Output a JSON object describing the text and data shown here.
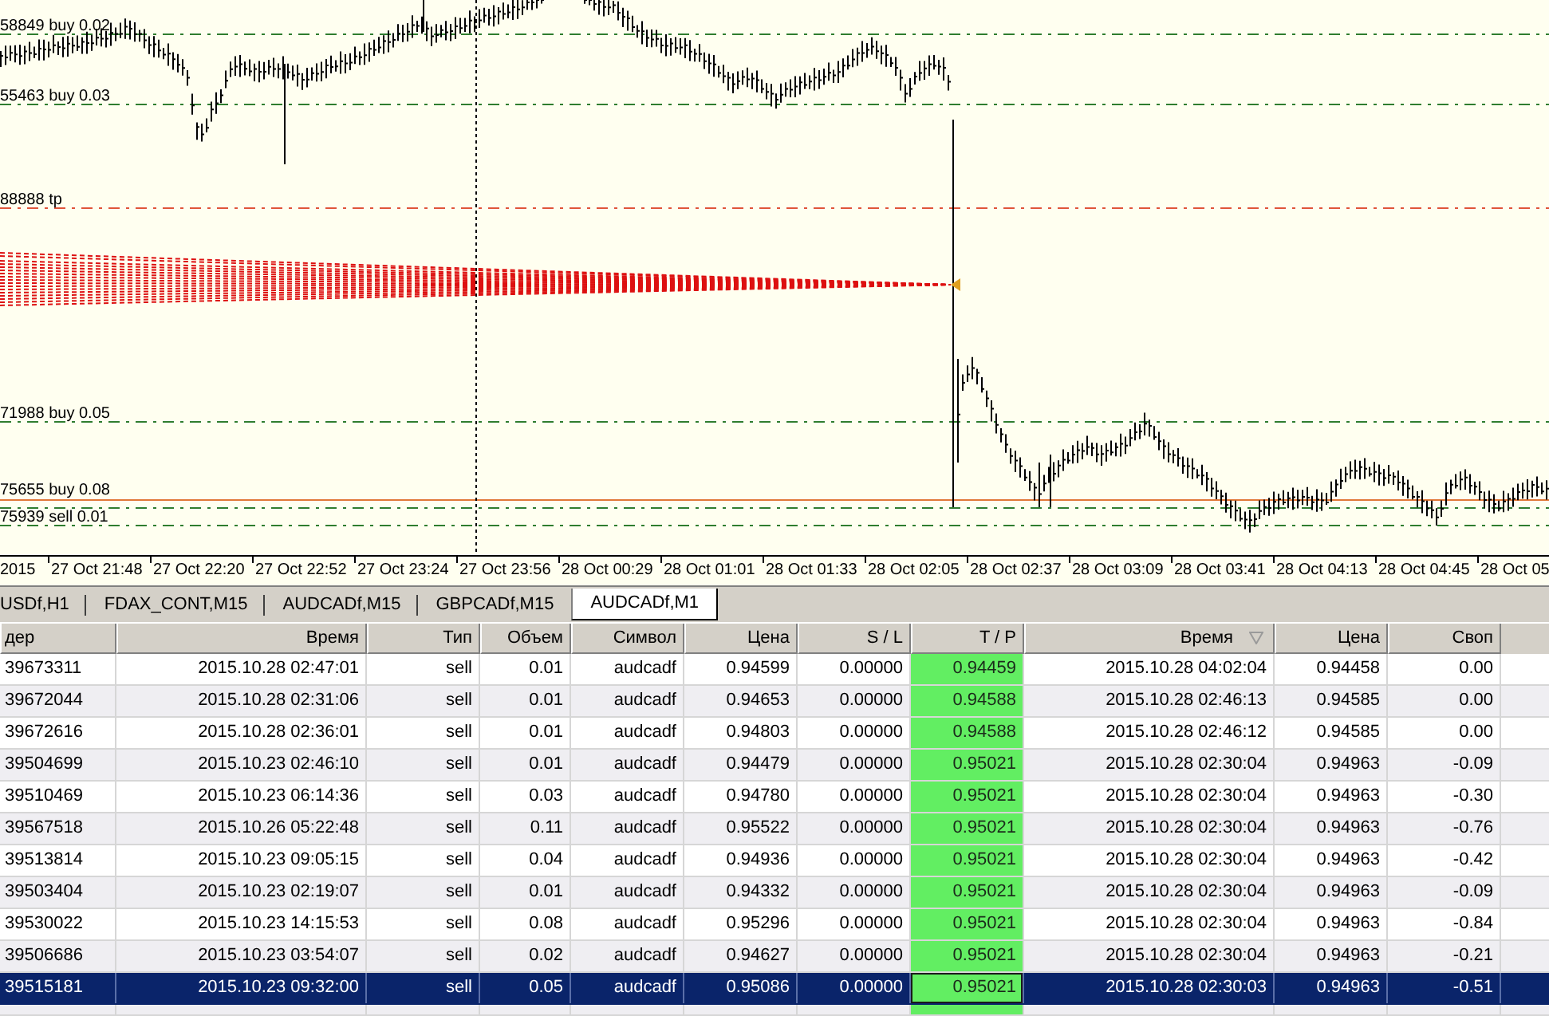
{
  "chart": {
    "levels": [
      {
        "label": "58849 buy 0.02",
        "kind": "order"
      },
      {
        "label": "55463 buy 0.03",
        "kind": "order"
      },
      {
        "label": "88888 tp",
        "kind": "take_profit"
      },
      {
        "label": "71988 buy 0.05",
        "kind": "order"
      },
      {
        "label": "75655 buy 0.08",
        "kind": "order"
      },
      {
        "label": "75939 sell 0.01",
        "kind": "order"
      }
    ],
    "time_axis": [
      "2015",
      "27 Oct 21:48",
      "27 Oct 22:20",
      "27 Oct 22:52",
      "27 Oct 23:24",
      "27 Oct 23:56",
      "28 Oct 00:29",
      "28 Oct 01:01",
      "28 Oct 01:33",
      "28 Oct 02:05",
      "28 Oct 02:37",
      "28 Oct 03:09",
      "28 Oct 03:41",
      "28 Oct 04:13",
      "28 Oct 04:45",
      "28 Oct 05"
    ]
  },
  "tabs": [
    {
      "label": "USDf,H1",
      "selected": false
    },
    {
      "label": "FDAX_CONT,M15",
      "selected": false
    },
    {
      "label": "AUDCADf,M15",
      "selected": false
    },
    {
      "label": "GBPCADf,M15",
      "selected": false
    },
    {
      "label": "AUDCADf,M1",
      "selected": true
    }
  ],
  "table": {
    "columns": [
      {
        "label": "дер",
        "sorted": false,
        "highlighted": false
      },
      {
        "label": "Время",
        "sorted": false,
        "highlighted": false
      },
      {
        "label": "Тип",
        "sorted": false,
        "highlighted": false
      },
      {
        "label": "Объем",
        "sorted": false,
        "highlighted": false
      },
      {
        "label": "Символ",
        "sorted": false,
        "highlighted": false
      },
      {
        "label": "Цена",
        "sorted": false,
        "highlighted": false
      },
      {
        "label": "S / L",
        "sorted": false,
        "highlighted": false
      },
      {
        "label": "T / P",
        "sorted": false,
        "highlighted": true
      },
      {
        "label": "Время",
        "sorted": true,
        "highlighted": false
      },
      {
        "label": "Цена",
        "sorted": false,
        "highlighted": false
      },
      {
        "label": "Своп",
        "sorted": false,
        "highlighted": false
      }
    ],
    "rows": [
      {
        "cells": [
          "39673311",
          "2015.10.28 02:47:01",
          "sell",
          "0.01",
          "audcadf",
          "0.94599",
          "0.00000",
          "0.94459",
          "2015.10.28 04:02:04",
          "0.94458",
          "0.00"
        ],
        "selected": false
      },
      {
        "cells": [
          "39672044",
          "2015.10.28 02:31:06",
          "sell",
          "0.01",
          "audcadf",
          "0.94653",
          "0.00000",
          "0.94588",
          "2015.10.28 02:46:13",
          "0.94585",
          "0.00"
        ],
        "selected": false
      },
      {
        "cells": [
          "39672616",
          "2015.10.28 02:36:01",
          "sell",
          "0.01",
          "audcadf",
          "0.94803",
          "0.00000",
          "0.94588",
          "2015.10.28 02:46:12",
          "0.94585",
          "0.00"
        ],
        "selected": false
      },
      {
        "cells": [
          "39504699",
          "2015.10.23 02:46:10",
          "sell",
          "0.01",
          "audcadf",
          "0.94479",
          "0.00000",
          "0.95021",
          "2015.10.28 02:30:04",
          "0.94963",
          "-0.09"
        ],
        "selected": false
      },
      {
        "cells": [
          "39510469",
          "2015.10.23 06:14:36",
          "sell",
          "0.03",
          "audcadf",
          "0.94780",
          "0.00000",
          "0.95021",
          "2015.10.28 02:30:04",
          "0.94963",
          "-0.30"
        ],
        "selected": false
      },
      {
        "cells": [
          "39567518",
          "2015.10.26 05:22:48",
          "sell",
          "0.11",
          "audcadf",
          "0.95522",
          "0.00000",
          "0.95021",
          "2015.10.28 02:30:04",
          "0.94963",
          "-0.76"
        ],
        "selected": false
      },
      {
        "cells": [
          "39513814",
          "2015.10.23 09:05:15",
          "sell",
          "0.04",
          "audcadf",
          "0.94936",
          "0.00000",
          "0.95021",
          "2015.10.28 02:30:04",
          "0.94963",
          "-0.42"
        ],
        "selected": false
      },
      {
        "cells": [
          "39503404",
          "2015.10.23 02:19:07",
          "sell",
          "0.01",
          "audcadf",
          "0.94332",
          "0.00000",
          "0.95021",
          "2015.10.28 02:30:04",
          "0.94963",
          "-0.09"
        ],
        "selected": false
      },
      {
        "cells": [
          "39530022",
          "2015.10.23 14:15:53",
          "sell",
          "0.08",
          "audcadf",
          "0.95296",
          "0.00000",
          "0.95021",
          "2015.10.28 02:30:04",
          "0.94963",
          "-0.84"
        ],
        "selected": false
      },
      {
        "cells": [
          "39506686",
          "2015.10.23 03:54:07",
          "sell",
          "0.02",
          "audcadf",
          "0.94627",
          "0.00000",
          "0.95021",
          "2015.10.28 02:30:04",
          "0.94963",
          "-0.21"
        ],
        "selected": false
      },
      {
        "cells": [
          "39515181",
          "2015.10.23 09:32:00",
          "sell",
          "0.05",
          "audcadf",
          "0.95086",
          "0.00000",
          "0.95021",
          "2015.10.28 02:30:03",
          "0.94963",
          "-0.51"
        ],
        "selected": true
      }
    ]
  }
}
